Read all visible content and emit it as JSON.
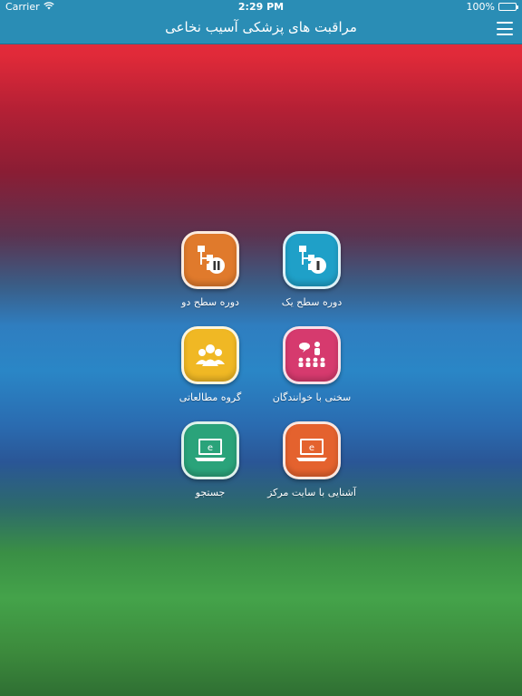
{
  "status_bar": {
    "carrier": "Carrier",
    "time": "2:29 PM",
    "battery": "100%"
  },
  "nav": {
    "title": "مراقبت های پزشکی آسیب نخاعی"
  },
  "tiles": [
    {
      "label": "دوره سطح یک",
      "color": "#1fa0c8"
    },
    {
      "label": "دوره سطح دو",
      "color": "#e07a2c"
    },
    {
      "label": "سخنی با خوانندگان",
      "color": "#d63a6e"
    },
    {
      "label": "گروه مطالعاتی",
      "color": "#f0b824"
    },
    {
      "label": "آشنایی با سایت مرکز",
      "color": "#e4622e"
    },
    {
      "label": "جستجو",
      "color": "#2aa37a"
    }
  ]
}
